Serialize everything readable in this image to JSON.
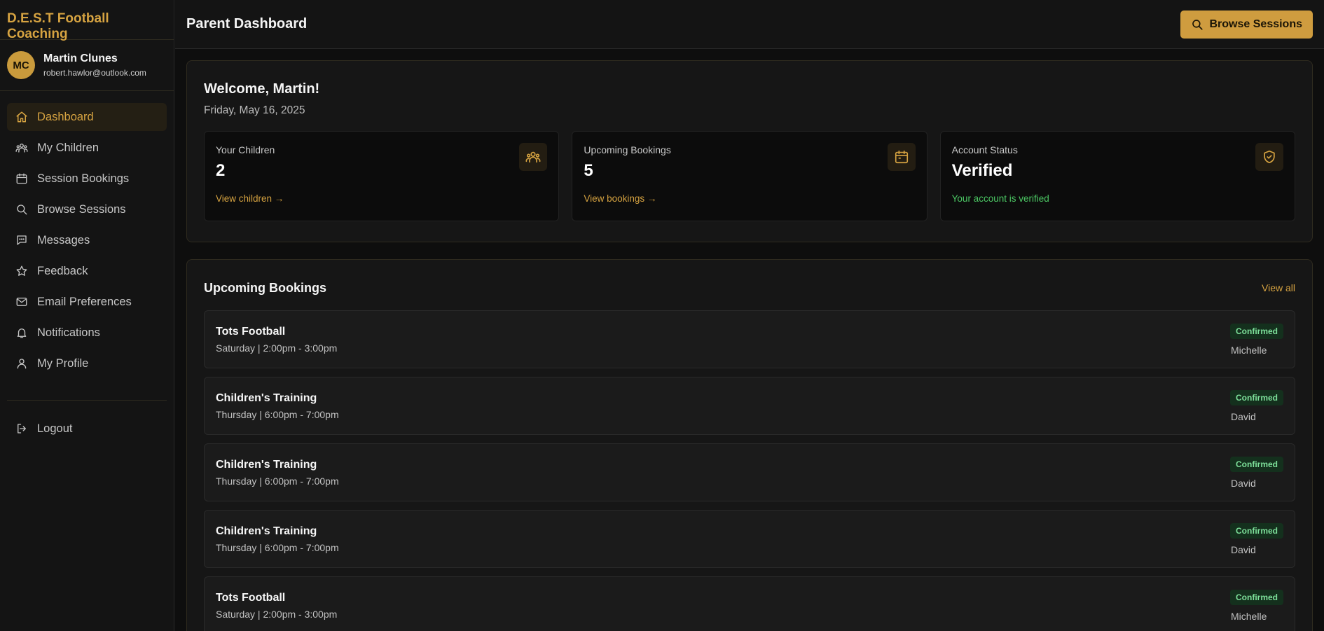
{
  "app": {
    "brand": "D.E.S.T Football Coaching"
  },
  "user": {
    "initials": "MC",
    "name": "Martin Clunes",
    "email": "robert.hawlor@outlook.com"
  },
  "sidebar": {
    "items": [
      {
        "label": "Dashboard",
        "icon": "home-icon",
        "active": true
      },
      {
        "label": "My Children",
        "icon": "users-icon"
      },
      {
        "label": "Session Bookings",
        "icon": "calendar-icon"
      },
      {
        "label": "Browse Sessions",
        "icon": "search-icon"
      },
      {
        "label": "Messages",
        "icon": "message-icon"
      },
      {
        "label": "Feedback",
        "icon": "star-icon"
      },
      {
        "label": "Email Preferences",
        "icon": "mail-icon"
      },
      {
        "label": "Notifications",
        "icon": "bell-icon"
      },
      {
        "label": "My Profile",
        "icon": "user-icon"
      }
    ],
    "logout": "Logout"
  },
  "header": {
    "title": "Parent Dashboard",
    "browse_label": "Browse Sessions"
  },
  "welcome": {
    "title": "Welcome, Martin!",
    "date": "Friday, May 16, 2025",
    "stats": [
      {
        "label": "Your Children",
        "value": "2",
        "link": "View children →",
        "icon": "users-icon"
      },
      {
        "label": "Upcoming Bookings",
        "value": "5",
        "link": "View bookings →",
        "icon": "calendar-icon"
      },
      {
        "label": "Account Status",
        "value": "Verified",
        "link": "Your account is verified",
        "icon": "shield-check-icon"
      }
    ]
  },
  "bookings": {
    "title": "Upcoming Bookings",
    "view_all": "View all",
    "items": [
      {
        "title": "Tots Football",
        "time": "Saturday | 2:00pm - 3:00pm",
        "status": "Confirmed",
        "child": "Michelle"
      },
      {
        "title": "Children's Training",
        "time": "Thursday | 6:00pm - 7:00pm",
        "status": "Confirmed",
        "child": "David"
      },
      {
        "title": "Children's Training",
        "time": "Thursday | 6:00pm - 7:00pm",
        "status": "Confirmed",
        "child": "David"
      },
      {
        "title": "Children's Training",
        "time": "Thursday | 6:00pm - 7:00pm",
        "status": "Confirmed",
        "child": "David"
      },
      {
        "title": "Tots Football",
        "time": "Saturday | 2:00pm - 3:00pm",
        "status": "Confirmed",
        "child": "Michelle"
      }
    ]
  },
  "colors": {
    "accent": "#d6a341",
    "success": "#4cc964",
    "badge_bg": "#14301d",
    "background": "#0e0e0e"
  }
}
